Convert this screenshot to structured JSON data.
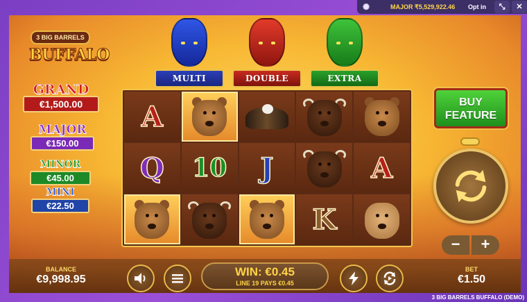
{
  "topbar": {
    "logo_icon": "bolt-swirl-icon",
    "jackpot_ticker": "MAJOR ₹5,529,922.46",
    "opt_in_label": "Opt in",
    "minimize_icon": "collapse-icon",
    "close_icon": "close-icon"
  },
  "logo": {
    "line1": "3 BIG BARRELS",
    "line2": "BUFFALO"
  },
  "jackpots": [
    {
      "name": "GRAND",
      "value": "€1,500.00",
      "color": "#b31b1b"
    },
    {
      "name": "MAJOR",
      "value": "€150.00",
      "color": "#7a2ab6"
    },
    {
      "name": "MINOR",
      "value": "€45.00",
      "color": "#1d8a27"
    },
    {
      "name": "MINI",
      "value": "€22.50",
      "color": "#2044a8"
    }
  ],
  "statues": [
    {
      "label": "MULTI",
      "color": "#2f56e6"
    },
    {
      "label": "DOUBLE",
      "color": "#e23a2a"
    },
    {
      "label": "EXTRA",
      "color": "#3ec23a"
    }
  ],
  "reels": {
    "symbols": [
      [
        "A",
        "bear",
        "eagle",
        "bison",
        "bear"
      ],
      [
        "Q",
        "10",
        "J",
        "bison",
        "A"
      ],
      [
        "bear",
        "bison",
        "bear",
        "K",
        "puma"
      ]
    ],
    "winning_cells": [
      [
        0,
        1
      ],
      [
        2,
        0
      ],
      [
        2,
        2
      ]
    ]
  },
  "buy_feature": {
    "line1": "BUY",
    "line2": "FEATURE"
  },
  "controls": {
    "minus_label": "−",
    "plus_label": "+",
    "spin_icon": "spin-arrows-icon"
  },
  "bottom": {
    "balance_label": "BALANCE",
    "balance_value": "€9,998.95",
    "win_text": "WIN: €0.45",
    "line_text": "LINE 19 PAYS €0.45",
    "bet_label": "BET",
    "bet_value": "€1.50",
    "sound_icon": "speaker-icon",
    "menu_icon": "hamburger-menu-icon",
    "turbo_icon": "lightning-icon",
    "autoplay_icon": "autoplay-icon",
    "game_title": "3 BIG BARRELS BUFFALO (DEMO)"
  }
}
